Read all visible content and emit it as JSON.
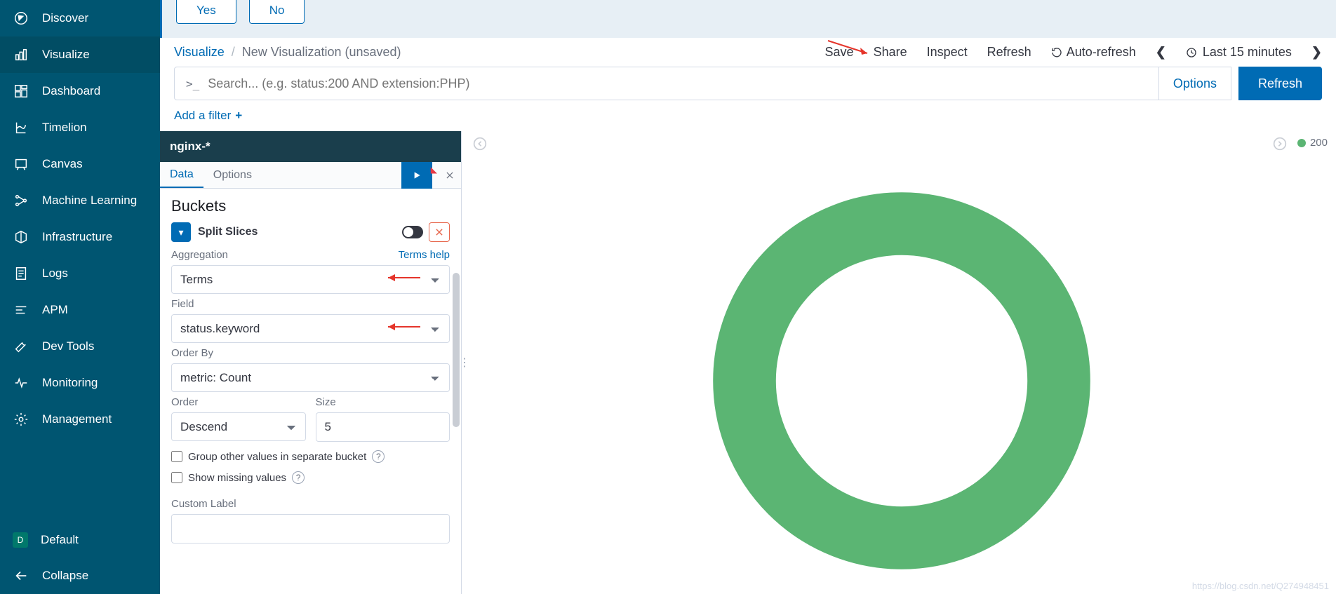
{
  "sidebar": {
    "items": [
      {
        "label": "Discover"
      },
      {
        "label": "Visualize"
      },
      {
        "label": "Dashboard"
      },
      {
        "label": "Timelion"
      },
      {
        "label": "Canvas"
      },
      {
        "label": "Machine Learning"
      },
      {
        "label": "Infrastructure"
      },
      {
        "label": "Logs"
      },
      {
        "label": "APM"
      },
      {
        "label": "Dev Tools"
      },
      {
        "label": "Monitoring"
      },
      {
        "label": "Management"
      }
    ],
    "default_space": {
      "initial": "D",
      "label": "Default"
    },
    "collapse_label": "Collapse"
  },
  "banner": {
    "yes": "Yes",
    "no": "No"
  },
  "breadcrumb": {
    "root": "Visualize",
    "current": "New Visualization (unsaved)"
  },
  "actions": {
    "save": "Save",
    "share": "Share",
    "inspect": "Inspect",
    "refresh": "Refresh",
    "auto_refresh": "Auto-refresh",
    "time_range": "Last 15 minutes"
  },
  "search": {
    "prompt": ">_",
    "placeholder": "Search... (e.g. status:200 AND extension:PHP)",
    "options": "Options",
    "refresh": "Refresh"
  },
  "filter": {
    "add": "Add a filter"
  },
  "config": {
    "index_pattern": "nginx-*",
    "tabs": {
      "data": "Data",
      "options": "Options"
    },
    "section_title": "Buckets",
    "bucket_name": "Split Slices",
    "aggregation": {
      "label": "Aggregation",
      "help": "Terms help",
      "value": "Terms"
    },
    "field": {
      "label": "Field",
      "value": "status.keyword"
    },
    "order_by": {
      "label": "Order By",
      "value": "metric: Count"
    },
    "order": {
      "label": "Order",
      "value": "Descend"
    },
    "size": {
      "label": "Size",
      "value": "5"
    },
    "group_other": "Group other values in separate bucket",
    "show_missing": "Show missing values",
    "custom_label": "Custom Label"
  },
  "legend": {
    "status_200": "200"
  },
  "chart_data": {
    "type": "pie",
    "donut": true,
    "title": "",
    "series": [
      {
        "name": "status.keyword",
        "slices": [
          {
            "label": "200",
            "value": 100,
            "color": "#5bb573"
          }
        ]
      }
    ]
  },
  "colors": {
    "accent": "#006bb4",
    "sidebar": "#005571",
    "green": "#5bb573"
  },
  "watermark": "https://blog.csdn.net/Q274948451"
}
